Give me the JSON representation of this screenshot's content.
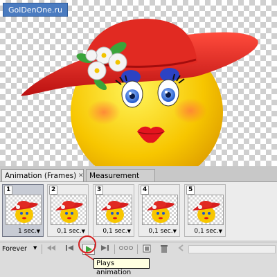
{
  "watermark": "GolDenOne.ru",
  "tabs": {
    "animation": "Animation (Frames)",
    "close": "✕",
    "measurement": "Measurement Log"
  },
  "frames": [
    {
      "number": "1",
      "delay": "1 sec.",
      "selected": true
    },
    {
      "number": "2",
      "delay": "0,1 sec.",
      "selected": false
    },
    {
      "number": "3",
      "delay": "0,1 sec.",
      "selected": false
    },
    {
      "number": "4",
      "delay": "0,1 sec.",
      "selected": false
    },
    {
      "number": "5",
      "delay": "0,1 sec.",
      "selected": false
    }
  ],
  "toolbar": {
    "loop": "Forever",
    "buttons": [
      "first-frame-icon",
      "previous-frame-icon",
      "play-icon",
      "next-frame-icon",
      "tween-icon",
      "duplicate-frame-icon",
      "delete-frame-icon"
    ]
  },
  "tooltip": "Plays animation",
  "colors": {
    "hat": "#d81e1e",
    "face": "#f7c600",
    "highlight": "#d42020",
    "play": "#3da63d"
  }
}
